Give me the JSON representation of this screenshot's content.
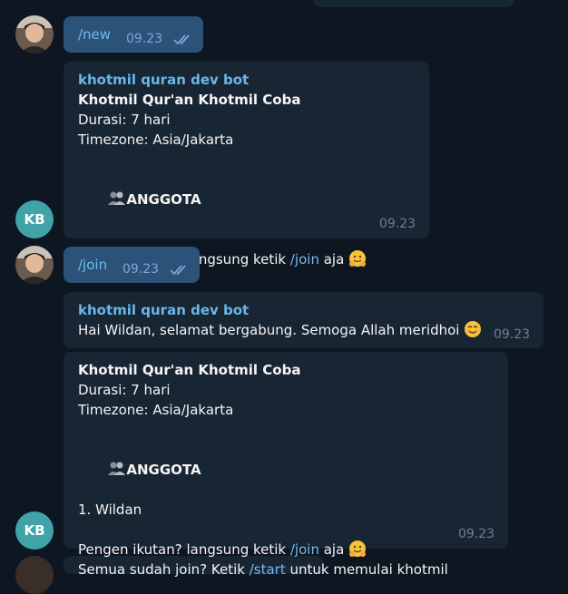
{
  "chat": {
    "bot_initials": "KB",
    "messages": {
      "m1": {
        "text": "/new",
        "time": "09.23"
      },
      "m2": {
        "sender": "khotmil quran dev bot",
        "title": "Khotmil Qur'an Khotmil Coba",
        "duration": "Durasi: 7 hari",
        "timezone": "Timezone: Asia/Jakarta",
        "members_heading": "ANGGOTA",
        "invite_before": "Pengen ikutan? langsung ketik ",
        "invite_cmd": "/join",
        "invite_after": " aja ",
        "time": "09.23"
      },
      "m3": {
        "text": "/join",
        "time": "09.23"
      },
      "m4": {
        "sender": "khotmil quran dev bot",
        "text": "Hai Wildan, selamat bergabung. Semoga Allah meridhoi ",
        "time": "09.23"
      },
      "m5": {
        "title": "Khotmil Qur'an Khotmil Coba",
        "duration": "Durasi: 7 hari",
        "timezone": "Timezone: Asia/Jakarta",
        "members_heading": "ANGGOTA",
        "member_1": "1. Wildan",
        "invite_before": "Pengen ikutan? langsung ketik ",
        "invite_cmd": "/join",
        "invite_after": " aja ",
        "start_before": "Semua sudah join? Ketik ",
        "start_cmd": "/start",
        "start_after": " untuk memulai khotmil",
        "time": "09.23"
      }
    }
  }
}
